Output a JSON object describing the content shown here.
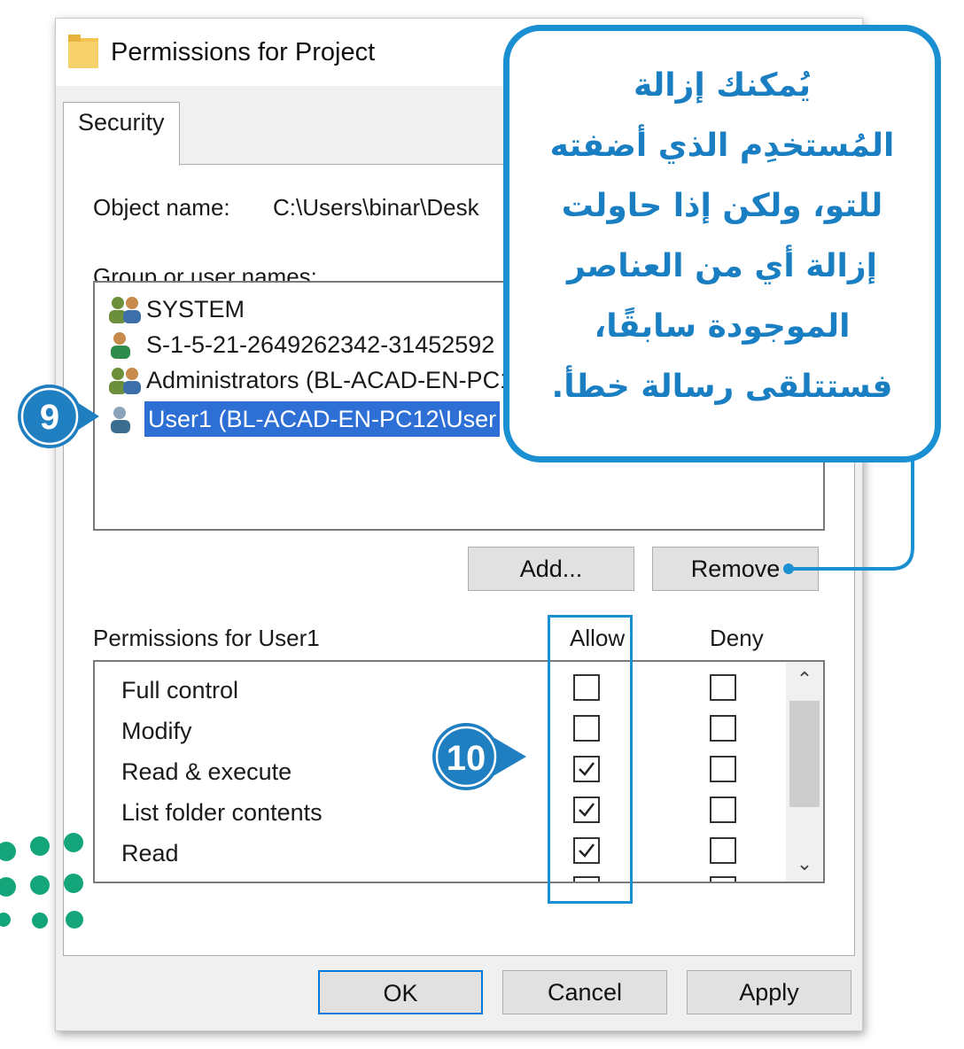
{
  "window": {
    "title": "Permissions for Project",
    "tab": "Security"
  },
  "object": {
    "label": "Object name:",
    "value": "C:\\Users\\binar\\Desk"
  },
  "groups": {
    "label": "Group or user names:",
    "items": [
      {
        "icon": "group-users-icon",
        "text": "SYSTEM"
      },
      {
        "icon": "user-icon",
        "text": "S-1-5-21-2649262342-31452592"
      },
      {
        "icon": "group-users-icon",
        "text": "Administrators (BL-ACAD-EN-PC1"
      },
      {
        "icon": "user-icon",
        "text": "User1 (BL-ACAD-EN-PC12\\User",
        "selected": true
      }
    ]
  },
  "buttons": {
    "add": "Add...",
    "remove": "Remove",
    "ok": "OK",
    "cancel": "Cancel",
    "apply": "Apply"
  },
  "permissions": {
    "label": "Permissions for User1",
    "allow_header": "Allow",
    "deny_header": "Deny",
    "rows": [
      {
        "name": "Full control",
        "allow": false,
        "deny": false
      },
      {
        "name": "Modify",
        "allow": false,
        "deny": false
      },
      {
        "name": "Read & execute",
        "allow": true,
        "deny": false
      },
      {
        "name": "List folder contents",
        "allow": true,
        "deny": false
      },
      {
        "name": "Read",
        "allow": true,
        "deny": false
      }
    ]
  },
  "annotations": {
    "step9": "9",
    "step10": "10"
  },
  "callout": {
    "lines": [
      "يُمكنك إزالة",
      "المُستخدِم الذي أضفته",
      "للتو، ولكن إذا حاولت",
      "إزالة أي من العناصر",
      "الموجودة سابقًا،",
      "فستتلقى رسالة خطأ."
    ]
  },
  "colors": {
    "accent": "#1a8fd1",
    "badge": "#1f7fc1",
    "selection": "#2d6fd4",
    "logo": "#14a57a"
  }
}
